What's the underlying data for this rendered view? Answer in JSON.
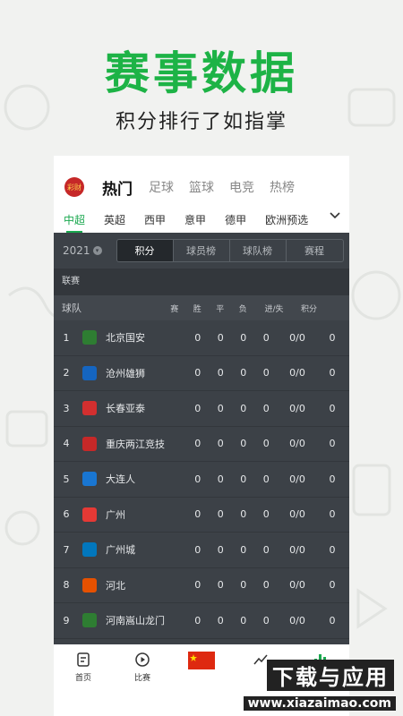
{
  "hero": {
    "title": "赛事数据",
    "subtitle": "积分排行了如指掌"
  },
  "logo": {
    "text": "彩财"
  },
  "top_tabs": [
    "热门",
    "足球",
    "篮球",
    "电竞",
    "热榜"
  ],
  "league_tabs": [
    "中超",
    "英超",
    "西甲",
    "意甲",
    "德甲",
    "欧洲预选"
  ],
  "season": "2021",
  "segments": [
    "积分",
    "球员榜",
    "球队榜",
    "赛程"
  ],
  "section_label": "联赛",
  "headers": {
    "team": "球队",
    "played": "赛",
    "win": "胜",
    "draw": "平",
    "loss": "负",
    "gd": "进/失",
    "points": "积分"
  },
  "rows": [
    {
      "rank": "1",
      "team": "北京国安",
      "played": "0",
      "win": "0",
      "draw": "0",
      "loss": "0",
      "gd": "0/0",
      "points": "0",
      "badge_color": "#2e7d32"
    },
    {
      "rank": "2",
      "team": "沧州雄狮",
      "played": "0",
      "win": "0",
      "draw": "0",
      "loss": "0",
      "gd": "0/0",
      "points": "0",
      "badge_color": "#1565c0"
    },
    {
      "rank": "3",
      "team": "长春亚泰",
      "played": "0",
      "win": "0",
      "draw": "0",
      "loss": "0",
      "gd": "0/0",
      "points": "0",
      "badge_color": "#d32f2f"
    },
    {
      "rank": "4",
      "team": "重庆两江竞技",
      "played": "0",
      "win": "0",
      "draw": "0",
      "loss": "0",
      "gd": "0/0",
      "points": "0",
      "badge_color": "#c62828"
    },
    {
      "rank": "5",
      "team": "大连人",
      "played": "0",
      "win": "0",
      "draw": "0",
      "loss": "0",
      "gd": "0/0",
      "points": "0",
      "badge_color": "#1976d2"
    },
    {
      "rank": "6",
      "team": "广州",
      "played": "0",
      "win": "0",
      "draw": "0",
      "loss": "0",
      "gd": "0/0",
      "points": "0",
      "badge_color": "#e53935"
    },
    {
      "rank": "7",
      "team": "广州城",
      "played": "0",
      "win": "0",
      "draw": "0",
      "loss": "0",
      "gd": "0/0",
      "points": "0",
      "badge_color": "#0277bd"
    },
    {
      "rank": "8",
      "team": "河北",
      "played": "0",
      "win": "0",
      "draw": "0",
      "loss": "0",
      "gd": "0/0",
      "points": "0",
      "badge_color": "#e65100"
    },
    {
      "rank": "9",
      "team": "河南嵩山龙门",
      "played": "0",
      "win": "0",
      "draw": "0",
      "loss": "0",
      "gd": "0/0",
      "points": "0",
      "badge_color": "#2e7d32"
    }
  ],
  "bottom_nav": [
    {
      "label": "首页",
      "icon": "home-doc-icon"
    },
    {
      "label": "比赛",
      "icon": "play-circle-icon"
    },
    {
      "label": "",
      "icon": "china-flag-icon"
    },
    {
      "label": "",
      "icon": "trend-icon"
    },
    {
      "label": "",
      "icon": "data-bars-icon"
    }
  ],
  "watermark": {
    "title": "下载与应用",
    "url": "www.xiazaimao.com"
  },
  "colors": {
    "accent": "#1db346",
    "table_bg": "#3c4147",
    "flag_red": "#de2910"
  }
}
